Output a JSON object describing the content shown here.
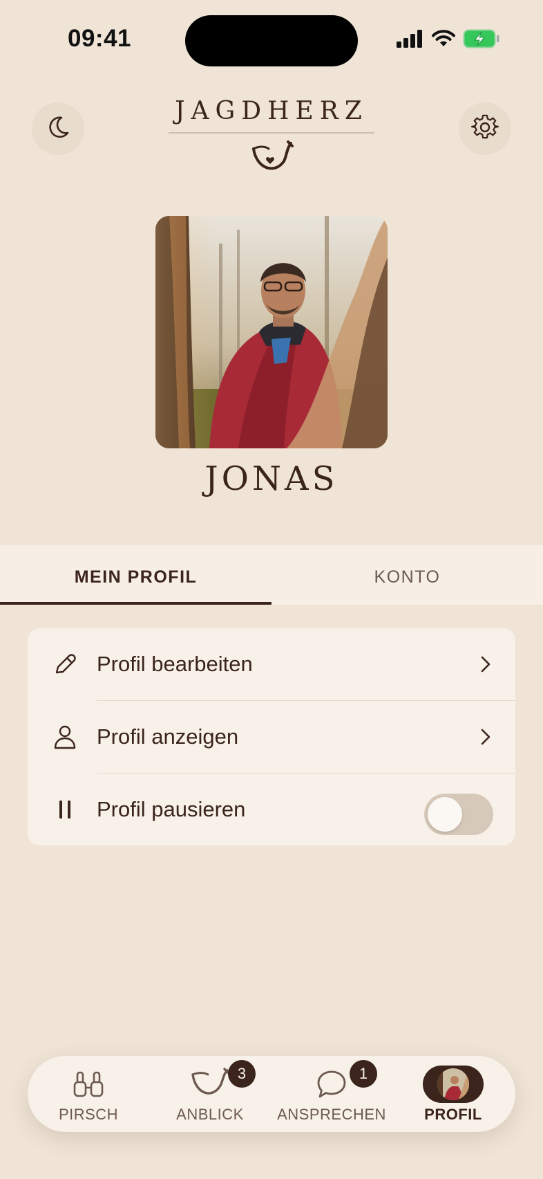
{
  "status_bar": {
    "time": "09:41",
    "icons": [
      "signal-icon",
      "wifi-icon",
      "battery-charging-icon"
    ]
  },
  "header": {
    "brand": "JAGDHERZ",
    "left_icon": "moon-icon",
    "right_icon": "gear-icon",
    "logo_icon": "horn-heart-icon"
  },
  "profile": {
    "name": "JONAS"
  },
  "tabs": [
    {
      "label": "MEIN PROFIL",
      "active": true
    },
    {
      "label": "KONTO",
      "active": false
    }
  ],
  "menu": {
    "items": [
      {
        "label": "Profil bearbeiten",
        "icon": "pencil-icon",
        "trailing": "chevron-right-icon"
      },
      {
        "label": "Profil anzeigen",
        "icon": "person-icon",
        "trailing": "chevron-right-icon"
      },
      {
        "label": "Profil pausieren",
        "icon": "pause-icon",
        "trailing": "toggle",
        "toggle_on": false
      }
    ]
  },
  "tabbar": {
    "items": [
      {
        "label": "PIRSCH",
        "icon": "binoculars-icon"
      },
      {
        "label": "ANBLICK",
        "icon": "horn-icon",
        "badge": "3"
      },
      {
        "label": "ANSPRECHEN",
        "icon": "chat-bubble-icon",
        "badge": "1"
      },
      {
        "label": "PROFIL",
        "icon": "avatar",
        "active": true
      }
    ]
  },
  "colors": {
    "background": "#efe4d6",
    "card": "#f8f1e9",
    "text": "#3a241c",
    "accent": "#3a241c",
    "battery": "#35c759"
  }
}
